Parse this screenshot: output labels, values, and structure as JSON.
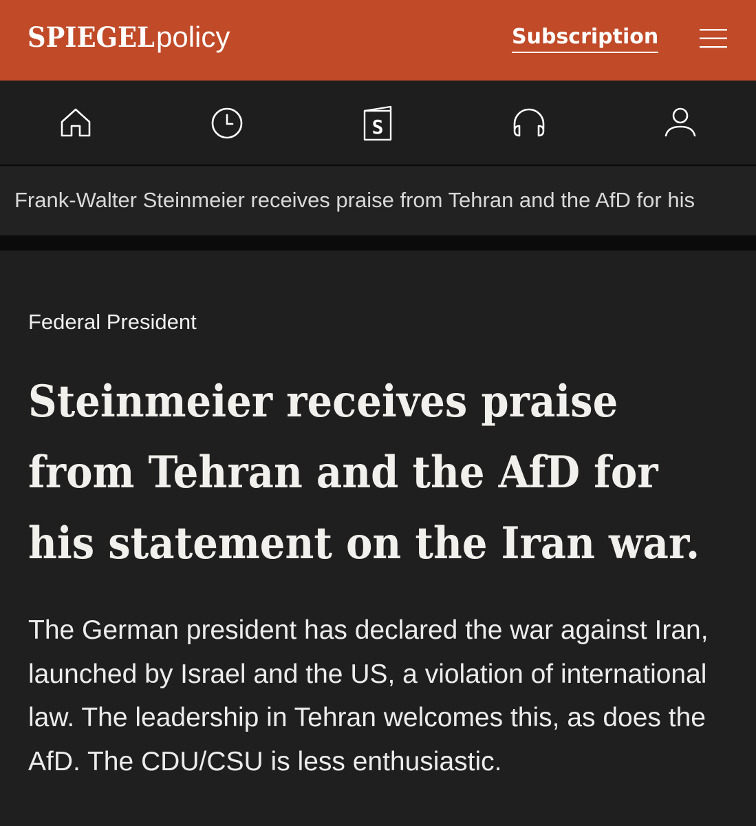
{
  "header": {
    "brand": "SPIEGEL",
    "section": "policy",
    "subscription_label": "Subscription",
    "menu_icon": "hamburger-menu-icon",
    "background": "#c14a28"
  },
  "nav": {
    "items": [
      {
        "name": "home",
        "icon": "home-icon"
      },
      {
        "name": "recent",
        "icon": "clock-icon"
      },
      {
        "name": "spiegel-plus",
        "icon": "spiegel-s-icon",
        "glyph": "S"
      },
      {
        "name": "audio",
        "icon": "headphones-icon"
      },
      {
        "name": "account",
        "icon": "user-icon"
      }
    ]
  },
  "ticker": {
    "text": "Frank-Walter Steinmeier receives praise from Tehran and the AfD for his"
  },
  "article": {
    "kicker": "Federal President",
    "headline": "Steinmeier receives praise from Tehran and the AfD for his statement on the Iran war.",
    "lead": "The German president has declared the war against Iran, launched by Israel and the US, a violation of international law. The leadership in Tehran welcomes this, as does the AfD. The CDU/CSU is less enthusiastic."
  },
  "colors": {
    "accent": "#c14a28",
    "page_background": "#1f1f1f",
    "text": "#f2f0ec"
  }
}
